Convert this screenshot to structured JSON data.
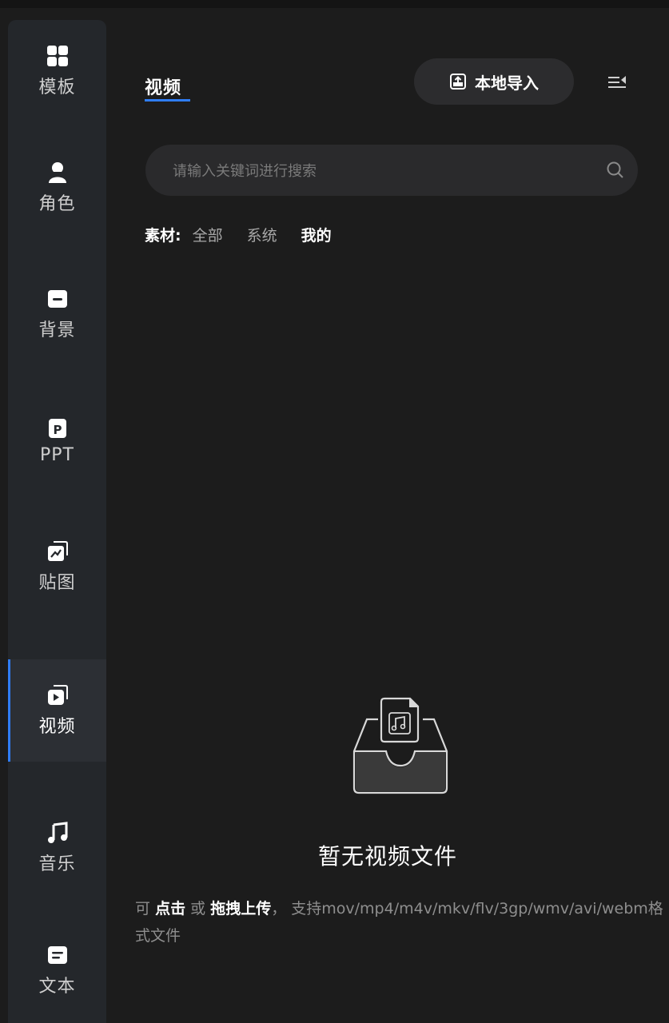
{
  "sidebar": {
    "items": [
      {
        "label": "模板",
        "icon": "template-grid-icon"
      },
      {
        "label": "角色",
        "icon": "person-icon"
      },
      {
        "label": "背景",
        "icon": "background-icon"
      },
      {
        "label": "PPT",
        "icon": "ppt-icon"
      },
      {
        "label": "贴图",
        "icon": "sticker-icon"
      },
      {
        "label": "视频",
        "icon": "video-icon",
        "active": true
      },
      {
        "label": "音乐",
        "icon": "music-note-icon"
      },
      {
        "label": "文本",
        "icon": "text-icon"
      }
    ]
  },
  "header": {
    "tab_label": "视频",
    "import_button_label": "本地导入"
  },
  "search": {
    "placeholder": "请输入关键词进行搜索",
    "value": ""
  },
  "filter": {
    "label": "素材:",
    "options": [
      "全部",
      "系统",
      "我的"
    ],
    "selected": "我的"
  },
  "empty_state": {
    "title": "暂无视频文件",
    "hint_prefix": "可",
    "hint_click": "点击",
    "hint_or": "或",
    "hint_drag": "拖拽上传",
    "hint_comma": "，",
    "hint_formats": "支持mov/mp4/m4v/mkv/flv/3gp/wmv/avi/webm格式文件"
  },
  "colors": {
    "accent": "#2f7df6",
    "background": "#1c1c1c",
    "sidebar": "#24272b"
  }
}
